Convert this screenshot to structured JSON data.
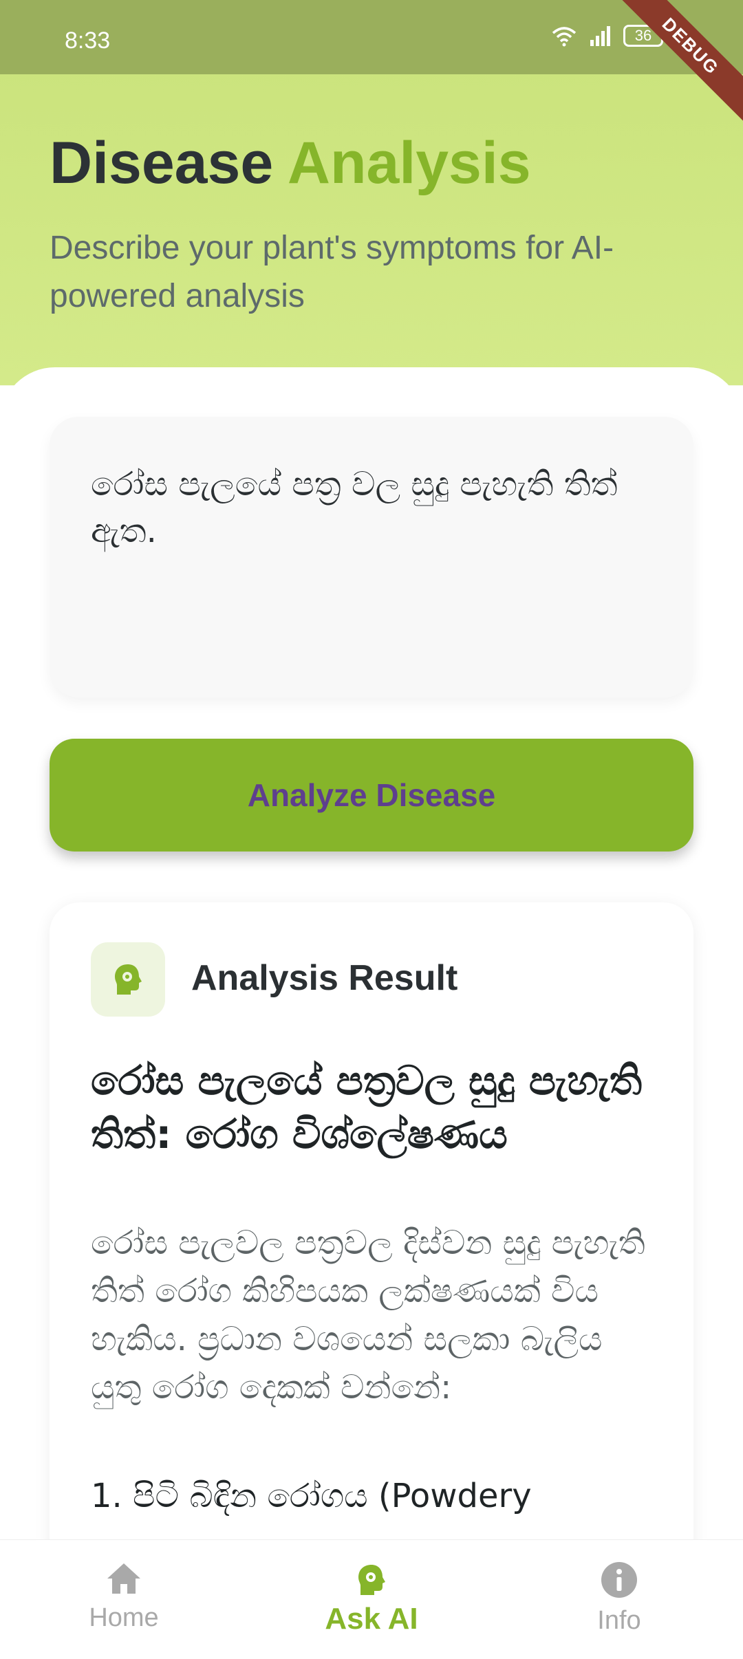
{
  "status_bar": {
    "time": "8:33",
    "battery": "36",
    "debug_label": "DEBUG"
  },
  "header": {
    "title_part1": "Disease",
    "title_part2": "Analysis",
    "subtitle": "Describe your plant's symptoms for AI-powered analysis"
  },
  "input": {
    "value": "රෝස පැලයේ පත්‍ර වල සුදු පැහැති තිත් ඇත."
  },
  "analyze_button": {
    "label": "Analyze Disease"
  },
  "result": {
    "header": "Analysis Result",
    "title": "රෝස පැලයේ පත්‍රවල සුදු පැහැති තිත්: රෝග විශ්ලේෂණය",
    "body": "රෝස පැලවල පත්‍රවල දිස්වන සුදු පැහැති තිත් රෝග කිහිපයක ලක්ෂණයක් විය හැකිය.  ප්‍රධාන වශයෙන් සලකා බැලිය යුතු රෝග දෙකක් වන්නේ:",
    "list_item_1": "1.  පිටි බිඳින රෝගය (Powdery"
  },
  "bottom_nav": {
    "items": [
      {
        "label": "Home",
        "icon": "home-icon"
      },
      {
        "label": "Ask AI",
        "icon": "ai-head-icon"
      },
      {
        "label": "Info",
        "icon": "info-icon"
      }
    ],
    "active_color": "#86b52a",
    "inactive_color": "#a9a9a9"
  },
  "colors": {
    "accent": "#86b52a",
    "header_bg": "#c9e27a",
    "button_text": "#5e3f8e"
  }
}
